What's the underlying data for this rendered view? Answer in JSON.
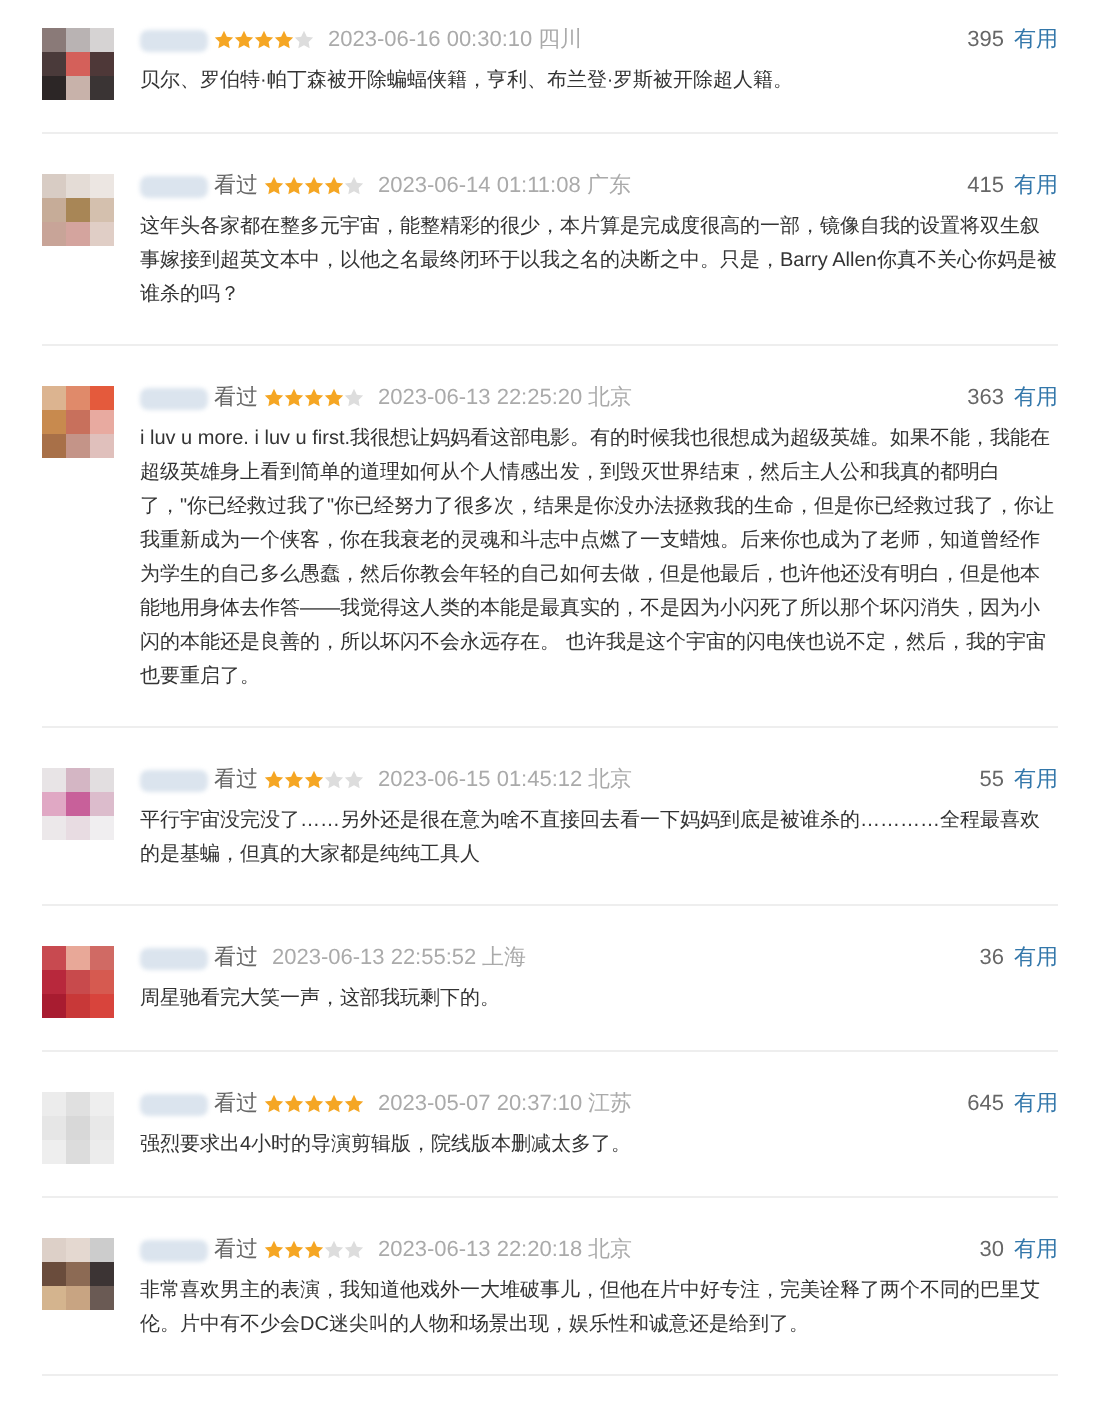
{
  "reviews": [
    {
      "stars": 4,
      "time": "2023-06-16 00:30:10",
      "location": "四川",
      "votes": "395",
      "vote_label": "有用",
      "text": "贝尔、罗伯特·帕丁森被开除蝙蝠侠籍，亨利、布兰登·罗斯被开除超人籍。"
    },
    {
      "status": "看过",
      "stars": 4,
      "time": "2023-06-14 01:11:08",
      "location": "广东",
      "votes": "415",
      "vote_label": "有用",
      "text": "这年头各家都在整多元宇宙，能整精彩的很少，本片算是完成度很高的一部，镜像自我的设置将双生叙事嫁接到超英文本中，以他之名最终闭环于以我之名的决断之中。只是，Barry Allen你真不关心你妈是被谁杀的吗？"
    },
    {
      "status": "看过",
      "stars": 4,
      "time": "2023-06-13 22:25:20",
      "location": "北京",
      "votes": "363",
      "vote_label": "有用",
      "text": "i luv u more. i luv u first.我很想让妈妈看这部电影。有的时候我也很想成为超级英雄。如果不能，我能在超级英雄身上看到简单的道理如何从个人情感出发，到毁灭世界结束，然后主人公和我真的都明白了，\"你已经救过我了\"你已经努力了很多次，结果是你没办法拯救我的生命，但是你已经救过我了，你让我重新成为一个侠客，你在我衰老的灵魂和斗志中点燃了一支蜡烛。后来你也成为了老师，知道曾经作为学生的自己多么愚蠢，然后你教会年轻的自己如何去做，但是他最后，也许他还没有明白，但是他本能地用身体去作答——我觉得这人类的本能是最真实的，不是因为小闪死了所以那个坏闪消失，因为小闪的本能还是良善的，所以坏闪不会永远存在。 也许我是这个宇宙的闪电侠也说不定，然后，我的宇宙也要重启了。"
    },
    {
      "status": "看过",
      "stars": 3,
      "time": "2023-06-15 01:45:12",
      "location": "北京",
      "votes": "55",
      "vote_label": "有用",
      "text": "平行宇宙没完没了……另外还是很在意为啥不直接回去看一下妈妈到底是被谁杀的…………全程最喜欢的是基蝙，但真的大家都是纯纯工具人"
    },
    {
      "status": "看过",
      "time": "2023-06-13 22:55:52",
      "location": "上海",
      "votes": "36",
      "vote_label": "有用",
      "text": "周星驰看完大笑一声，这部我玩剩下的。"
    },
    {
      "status": "看过",
      "stars": 5,
      "time": "2023-05-07 20:37:10",
      "location": "江苏",
      "votes": "645",
      "vote_label": "有用",
      "text": "强烈要求出4小时的导演剪辑版，院线版本删减太多了。"
    },
    {
      "status": "看过",
      "stars": 3,
      "time": "2023-06-13 22:20:18",
      "location": "北京",
      "votes": "30",
      "vote_label": "有用",
      "text": "非常喜欢男主的表演，我知道他戏外一大堆破事儿，但他在片中好专注，完美诠释了两个不同的巴里艾伦。片中有不少会DC迷尖叫的人物和场景出现，娱乐性和诚意还是给到了。"
    }
  ]
}
